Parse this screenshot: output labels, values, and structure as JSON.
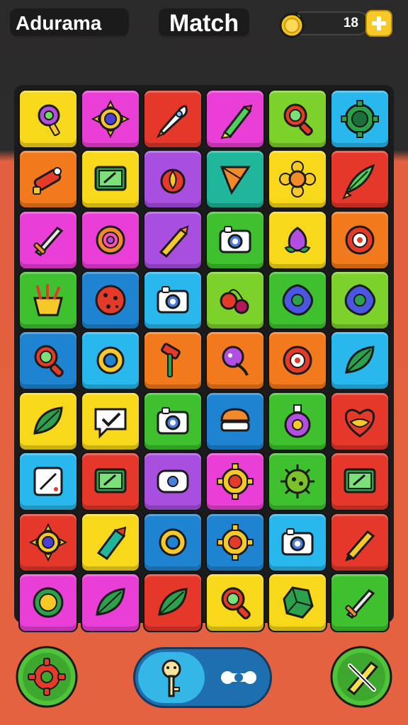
{
  "header": {
    "title_left": "Adurama",
    "title_center": "Match",
    "coins": "18"
  },
  "colors": {
    "yellow": "#f7d81a",
    "magenta": "#e93fd6",
    "red": "#e5382b",
    "green": "#3fc12f",
    "lime": "#7cd22a",
    "cyan": "#28b8ee",
    "blue": "#1e84d2",
    "orange": "#f27a1c",
    "purple": "#a84fe0",
    "teal": "#1fb69c",
    "pink": "#ff4fb0"
  },
  "board": {
    "rows": [
      [
        "yellow:lollipop-icon",
        "magenta:sun-gear-icon",
        "red:rocket-icon",
        "magenta:pencil-icon",
        "lime:magnifier-icon",
        "cyan:turtle-gear-icon"
      ],
      [
        "orange:lighter-icon",
        "yellow:screen-icon",
        "purple:flame-pot-icon",
        "teal:kite-icon",
        "yellow:flower-icon",
        "red:leaf-rocket-icon"
      ],
      [
        "magenta:sword-icon",
        "magenta:donut-icon",
        "purple:crayon-icon",
        "green:camera-icon",
        "yellow:berry-icon",
        "orange:disc-icon"
      ],
      [
        "green:basket-icon",
        "blue:cookie-icon",
        "cyan:camera-icon",
        "lime:cherries-icon",
        "green:blob-icon",
        "lime:blob-icon"
      ],
      [
        "blue:magnifier-icon",
        "cyan:ring-icon",
        "orange:hammer-icon",
        "orange:creature-icon",
        "orange:disc-icon",
        "cyan:leaf-icon"
      ],
      [
        "yellow:leaf-icon",
        "yellow:chat-check-icon",
        "green:camera-icon",
        "blue:burger-icon",
        "green:potion-icon",
        "red:heart-icon"
      ],
      [
        "cyan:tablet-icon",
        "red:screen-icon",
        "purple:robot-icon",
        "magenta:gear-icon",
        "green:virus-icon",
        "red:screen-icon"
      ],
      [
        "red:sun-gear-icon",
        "yellow:crystal-icon",
        "blue:ring-icon",
        "blue:gear-icon",
        "cyan:camera-icon",
        "red:marker-icon"
      ],
      [
        "magenta:shield-icon",
        "magenta:leaf-icon",
        "red:leaf-icon",
        "yellow:magnifier-icon",
        "yellow:rock-icon",
        "green:sword-icon"
      ]
    ]
  },
  "controls": {
    "left_icon": "gear-icon",
    "toggle_left_icon": "key-icon",
    "toggle_right_icon": "bone-icon",
    "right_icon": "pen-icon"
  }
}
